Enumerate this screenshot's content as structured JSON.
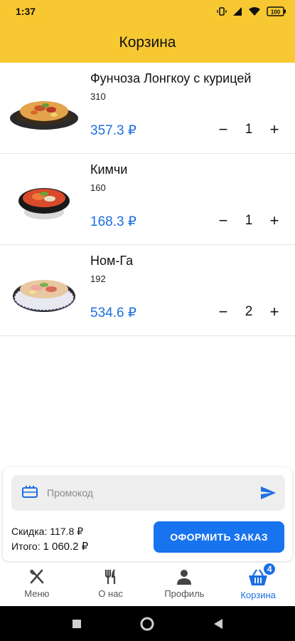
{
  "status": {
    "time": "1:37",
    "battery": "100"
  },
  "header": {
    "title": "Корзина"
  },
  "cart": [
    {
      "name": "Фунчоза Лонгкоу с курицей",
      "weight": "310",
      "price": "357.3 ₽",
      "qty": "1",
      "minus": "−",
      "plus": "+",
      "image_icon": "noodles-plate-image"
    },
    {
      "name": "Кимчи",
      "weight": "160",
      "price": "168.3 ₽",
      "qty": "1",
      "minus": "−",
      "plus": "+",
      "image_icon": "kimchi-bowl-image"
    },
    {
      "name": "Ном-Га",
      "weight": "192",
      "price": "534.6 ₽",
      "qty": "2",
      "minus": "−",
      "plus": "+",
      "image_icon": "nom-ga-bowl-image"
    }
  ],
  "promo": {
    "placeholder": "Промокод"
  },
  "summary": {
    "discount_label": "Скидка:",
    "discount_value": "117.8 ₽",
    "total_label": "Итого:",
    "total_value": "1 060.2 ₽",
    "checkout_label": "ОФОРМИТЬ ЗАКАЗ"
  },
  "nav": {
    "items": [
      {
        "label": "Меню",
        "icon": "fork-knife-icon"
      },
      {
        "label": "О нас",
        "icon": "cutlery-icon"
      },
      {
        "label": "Профиль",
        "icon": "person-icon"
      },
      {
        "label": "Корзина",
        "icon": "basket-icon"
      }
    ],
    "badge": "4"
  },
  "colors": {
    "accent": "#f8c832",
    "primary": "#1773ee",
    "price": "#1e6fe0"
  }
}
